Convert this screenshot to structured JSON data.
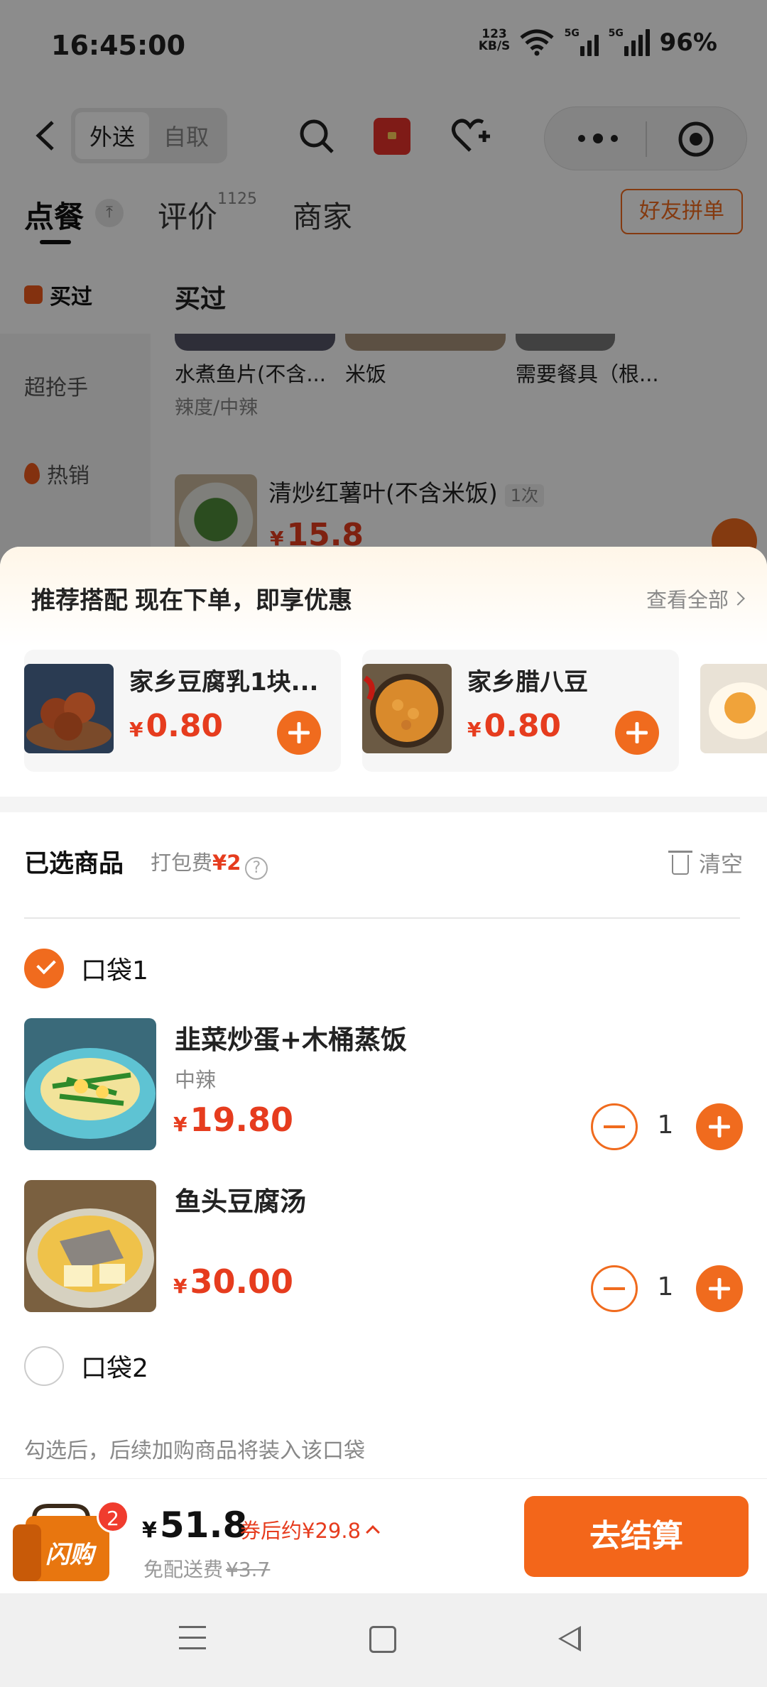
{
  "status_bar": {
    "time": "16:45:00",
    "net_speed_value": "123",
    "net_speed_unit": "KB/S",
    "sim1": "5G",
    "sim2": "5G",
    "battery": "96%"
  },
  "nav": {
    "segments": [
      "外送",
      "自取"
    ],
    "active_segment": 0
  },
  "tabs": [
    {
      "label": "点餐"
    },
    {
      "label": "评价",
      "count": "1125"
    },
    {
      "label": "商家"
    }
  ],
  "friend_button": "好友拼单",
  "sidebar": {
    "items": [
      {
        "label": "买过"
      },
      {
        "label": "超抢手"
      },
      {
        "label": "热销"
      }
    ]
  },
  "menu": {
    "section_title": "买过",
    "bought": [
      {
        "name": "水煮鱼片(不含...",
        "spec": "辣度/中辣"
      },
      {
        "name": "米饭",
        "spec": ""
      },
      {
        "name": "需要餐具（根...",
        "spec": ""
      }
    ],
    "dish": {
      "name": "清炒红薯叶(不含米饭)",
      "times": "1次",
      "currency": "¥",
      "price": "15.8"
    }
  },
  "recommend": {
    "title": "推荐搭配",
    "subtitle": "现在下单，即享优惠",
    "see_all": "查看全部",
    "items": [
      {
        "name": "家乡豆腐乳1块...",
        "currency": "¥",
        "price": "0.80"
      },
      {
        "name": "家乡腊八豆",
        "currency": "¥",
        "price": "0.80"
      }
    ]
  },
  "selected": {
    "title": "已选商品",
    "packing_fee_label": "打包费",
    "packing_fee": "¥2",
    "clear": "清空",
    "bags": [
      {
        "label": "口袋1",
        "checked": true
      },
      {
        "label": "口袋2",
        "checked": false
      }
    ],
    "items": [
      {
        "name": "韭菜炒蛋+木桶蒸饭",
        "spec": "中辣",
        "currency": "¥",
        "price": "19.80",
        "qty": "1"
      },
      {
        "name": "鱼头豆腐汤",
        "spec": "",
        "currency": "¥",
        "price": "30.00",
        "qty": "1"
      }
    ],
    "hint": "勾选后，后续加购商品将装入该口袋"
  },
  "checkout": {
    "badge": "2",
    "brand_text": "闪购",
    "currency": "¥",
    "total": "51.8",
    "after_coupon": "券后约¥29.8",
    "shipping_label": "免配送费",
    "shipping_original": "¥3.7",
    "pay_label": "去结算"
  },
  "colors": {
    "accent": "#f06b1e",
    "price": "#e63c1e",
    "pay_button": "#f3661a"
  }
}
